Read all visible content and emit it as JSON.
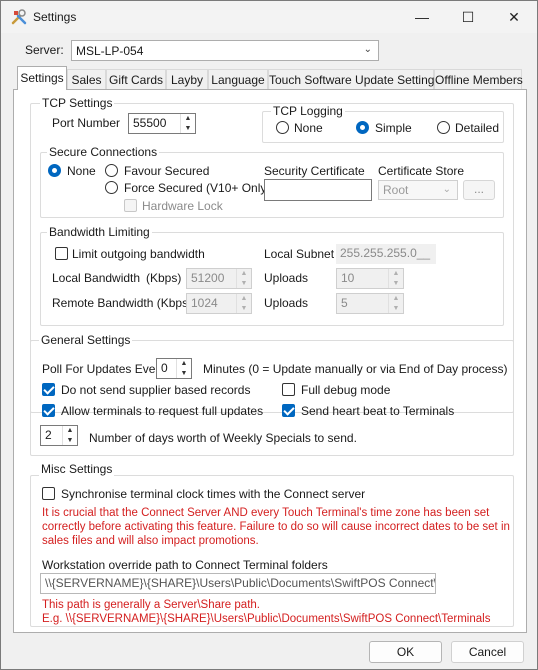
{
  "window": {
    "title": "Settings",
    "minimize": "—",
    "maximize": "☐",
    "close": "✕"
  },
  "server": {
    "label": "Server:",
    "value": "MSL-LP-054"
  },
  "tabs": [
    {
      "label": "Settings",
      "active": true
    },
    {
      "label": "Sales"
    },
    {
      "label": "Gift Cards"
    },
    {
      "label": "Layby"
    },
    {
      "label": "Language"
    },
    {
      "label": "Touch Software Update Settings"
    },
    {
      "label": "Offline Members"
    }
  ],
  "tcp_settings": {
    "title": "TCP Settings",
    "port_label": "Port Number",
    "port_value": "55500"
  },
  "tcp_logging": {
    "title": "TCP Logging",
    "options": [
      "None",
      "Simple",
      "Detailed"
    ],
    "selected": "Simple"
  },
  "secure_connections": {
    "title": "Secure Connections",
    "none_label": "None",
    "favour_label": "Favour Secured",
    "force_label": "Force Secured (V10+ Only)",
    "hardware_lock_label": "Hardware Lock",
    "selected": "None",
    "certificate_label": "Security Certificate",
    "certificate_value": "",
    "store_label": "Certificate Store",
    "store_value": "Root",
    "browse_label": "..."
  },
  "bandwidth": {
    "title": "Bandwidth Limiting",
    "limit_label": "Limit outgoing bandwidth",
    "local_subnet_label": "Local Subnet",
    "local_subnet_value": "255.255.255.0__",
    "local_bw_label": "Local Bandwidth",
    "kbps_label": "(Kbps)",
    "local_bw_value": "51200",
    "remote_bw_label": "Remote Bandwidth (Kbps)",
    "remote_bw_value": "1024",
    "uploads_label_1": "Uploads",
    "uploads_value_1": "10",
    "uploads_label_2": "Uploads",
    "uploads_value_2": "5"
  },
  "general": {
    "title": "General Settings",
    "poll_label": "Poll For Updates Every",
    "poll_value": "0",
    "poll_suffix": "Minutes (0 = Update manually or via End of Day process)",
    "supplier_label": "Do not send supplier based records",
    "debug_label": "Full debug mode",
    "full_updates_label": "Allow terminals to request full updates",
    "heartbeat_label": "Send heart beat to Terminals",
    "days_value": "2",
    "days_label": "Number of days worth of Weekly Specials to send."
  },
  "misc": {
    "title": "Misc Settings",
    "sync_label": "Synchronise terminal clock times with the Connect server",
    "warning_line1": "It is crucial that the Connect Server AND every Touch Terminal's time zone has been set",
    "warning_line2": "correctly before activating this feature.  Failure to do so will cause incorrect dates to be set in",
    "warning_line3": "sales files and will also impact promotions.",
    "override_label": "Workstation override path to Connect Terminal folders",
    "override_value": "\\\\{SERVERNAME}\\{SHARE}\\Users\\Public\\Documents\\SwiftPOS Connect\\Terminals",
    "hint_line1": "This path is generally a Server\\Share path.",
    "hint_line2": "E.g.  \\\\{SERVERNAME}\\{SHARE}\\Users\\Public\\Documents\\SwiftPOS Connect\\Terminals"
  },
  "footer": {
    "ok_label": "OK",
    "cancel_label": "Cancel"
  },
  "colors": {
    "accent": "#0067c0",
    "warning": "#d42020"
  }
}
